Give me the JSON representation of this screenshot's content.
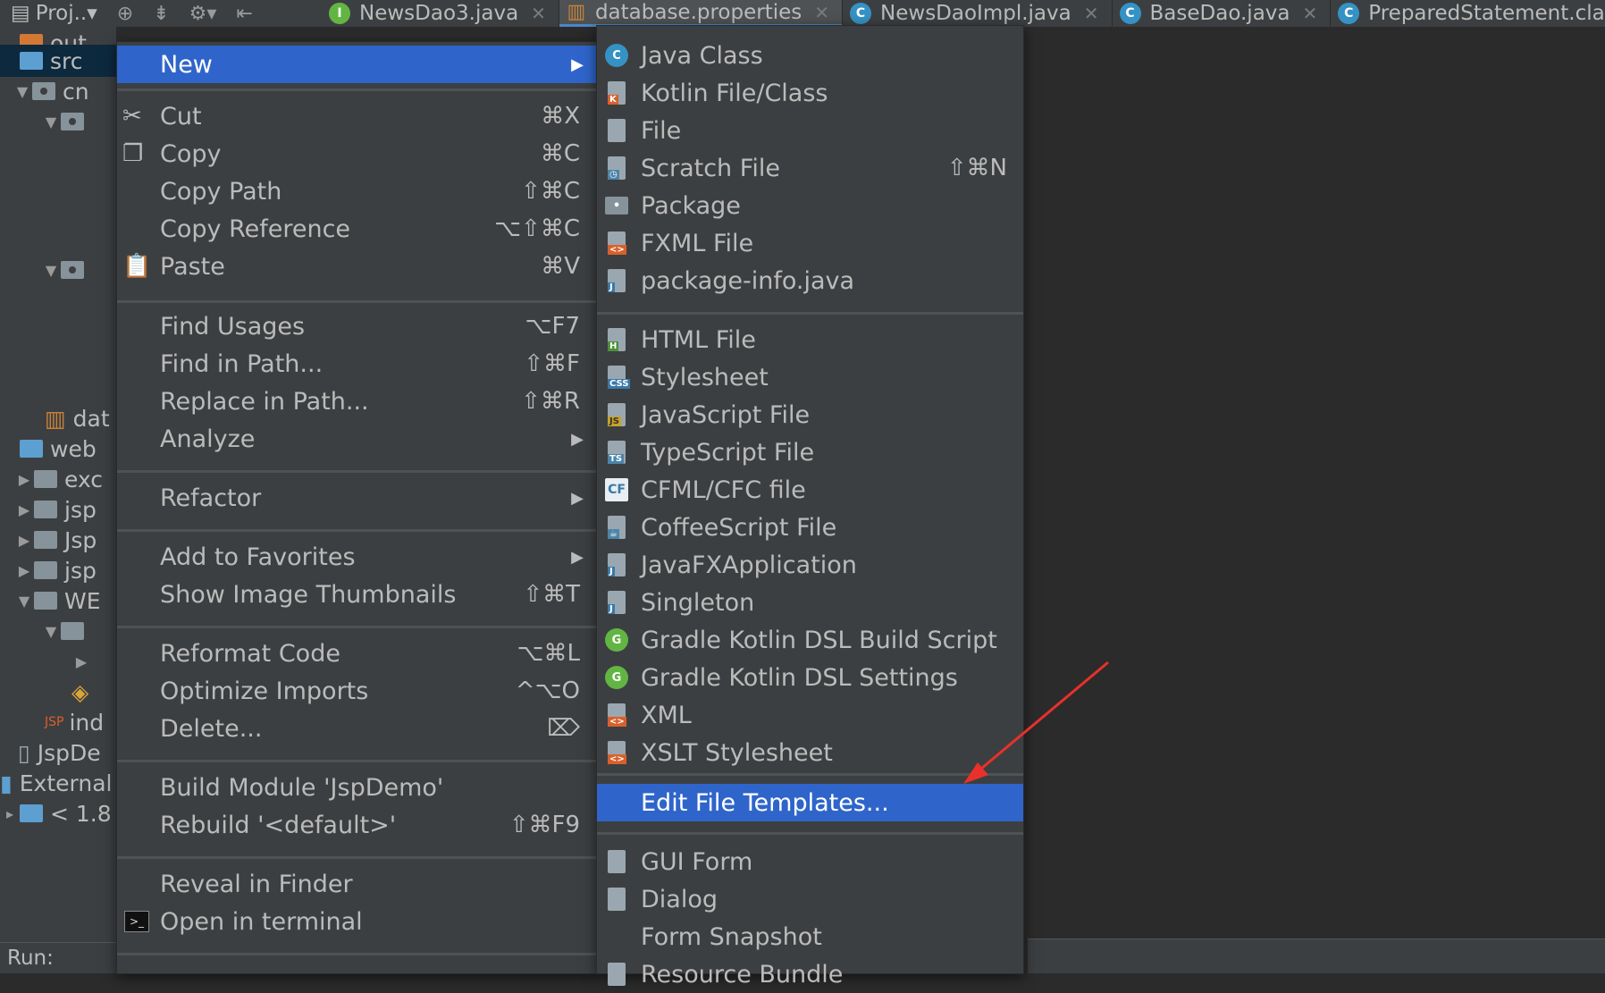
{
  "project_header": {
    "title": "Proj..▾"
  },
  "tabs": [
    {
      "label": "NewsDao3.java",
      "badge": "I",
      "badge_color": "#62b543"
    },
    {
      "label": "database.properties",
      "badge": "chart",
      "badge_color": "#c9823a"
    },
    {
      "label": "NewsDaoImpl.java",
      "badge": "C",
      "badge_color": "#3592c4"
    },
    {
      "label": "BaseDao.java",
      "badge": "C",
      "badge_color": "#3592c4"
    },
    {
      "label": "PreparedStatement.class",
      "badge": "C",
      "badge_color": "#3592c4"
    }
  ],
  "tree": [
    {
      "label": "out"
    },
    {
      "label": "src"
    },
    {
      "label": "cn"
    },
    {
      "label": ""
    },
    {
      "label": ""
    },
    {
      "label": "dat"
    },
    {
      "label": "web"
    },
    {
      "label": "exc"
    },
    {
      "label": "jsp"
    },
    {
      "label": "Jsp"
    },
    {
      "label": "jsp"
    },
    {
      "label": "WE"
    },
    {
      "label": ""
    },
    {
      "label": ""
    },
    {
      "label": ""
    },
    {
      "label": "ind"
    },
    {
      "label": "JspDe"
    },
    {
      "label": "External"
    },
    {
      "label": "< 1.8 :"
    }
  ],
  "run_label": "Run:",
  "context_menu": {
    "new": {
      "label": "New"
    },
    "cut": {
      "label": "Cut",
      "shortcut": "⌘X"
    },
    "copy": {
      "label": "Copy",
      "shortcut": "⌘C"
    },
    "copy_path": {
      "label": "Copy Path",
      "shortcut": "⇧⌘C"
    },
    "copy_reference": {
      "label": "Copy Reference",
      "shortcut": "⌥⇧⌘C"
    },
    "paste": {
      "label": "Paste",
      "shortcut": "⌘V"
    },
    "find_usages": {
      "label": "Find Usages",
      "shortcut": "⌥F7"
    },
    "find_in_path": {
      "label": "Find in Path...",
      "shortcut": "⇧⌘F"
    },
    "replace_in_path": {
      "label": "Replace in Path...",
      "shortcut": "⇧⌘R"
    },
    "analyze": {
      "label": "Analyze"
    },
    "refactor": {
      "label": "Refactor"
    },
    "add_to_favorites": {
      "label": "Add to Favorites"
    },
    "show_image_thumbnails": {
      "label": "Show Image Thumbnails",
      "shortcut": "⇧⌘T"
    },
    "reformat_code": {
      "label": "Reformat Code",
      "shortcut": "⌥⌘L"
    },
    "optimize_imports": {
      "label": "Optimize Imports",
      "shortcut": "^⌥O"
    },
    "delete": {
      "label": "Delete...",
      "shortcut": "⌦"
    },
    "build_module": {
      "label": "Build Module 'JspDemo'"
    },
    "rebuild": {
      "label": "Rebuild '<default>'",
      "shortcut": "⇧⌘F9"
    },
    "reveal_in_finder": {
      "label": "Reveal in Finder"
    },
    "open_in_terminal": {
      "label": "Open in terminal"
    }
  },
  "new_submenu": {
    "java_class": {
      "label": "Java Class"
    },
    "kotlin": {
      "label": "Kotlin File/Class"
    },
    "file": {
      "label": "File"
    },
    "scratch": {
      "label": "Scratch File",
      "shortcut": "⇧⌘N"
    },
    "package": {
      "label": "Package"
    },
    "fxml": {
      "label": "FXML File"
    },
    "package_info": {
      "label": "package-info.java"
    },
    "html": {
      "label": "HTML File"
    },
    "stylesheet": {
      "label": "Stylesheet"
    },
    "javascript": {
      "label": "JavaScript File"
    },
    "typescript": {
      "label": "TypeScript File"
    },
    "cfml": {
      "label": "CFML/CFC file"
    },
    "coffeescript": {
      "label": "CoffeeScript File"
    },
    "javafx": {
      "label": "JavaFXApplication"
    },
    "singleton": {
      "label": "Singleton"
    },
    "gradle_build": {
      "label": "Gradle Kotlin DSL Build Script"
    },
    "gradle_settings": {
      "label": "Gradle Kotlin DSL Settings"
    },
    "xml": {
      "label": "XML"
    },
    "xslt": {
      "label": "XSLT Stylesheet"
    },
    "edit_templates": {
      "label": "Edit File Templates..."
    },
    "gui_form": {
      "label": "GUI Form"
    },
    "dialog": {
      "label": "Dialog"
    },
    "form_snapshot": {
      "label": "Form Snapshot"
    },
    "resource_bundle": {
      "label": "Resource Bundle"
    }
  },
  "colors": {
    "selection": "#2f65ca",
    "menu_bg": "#3c3f41",
    "annotation_arrow": "#e8312a"
  }
}
